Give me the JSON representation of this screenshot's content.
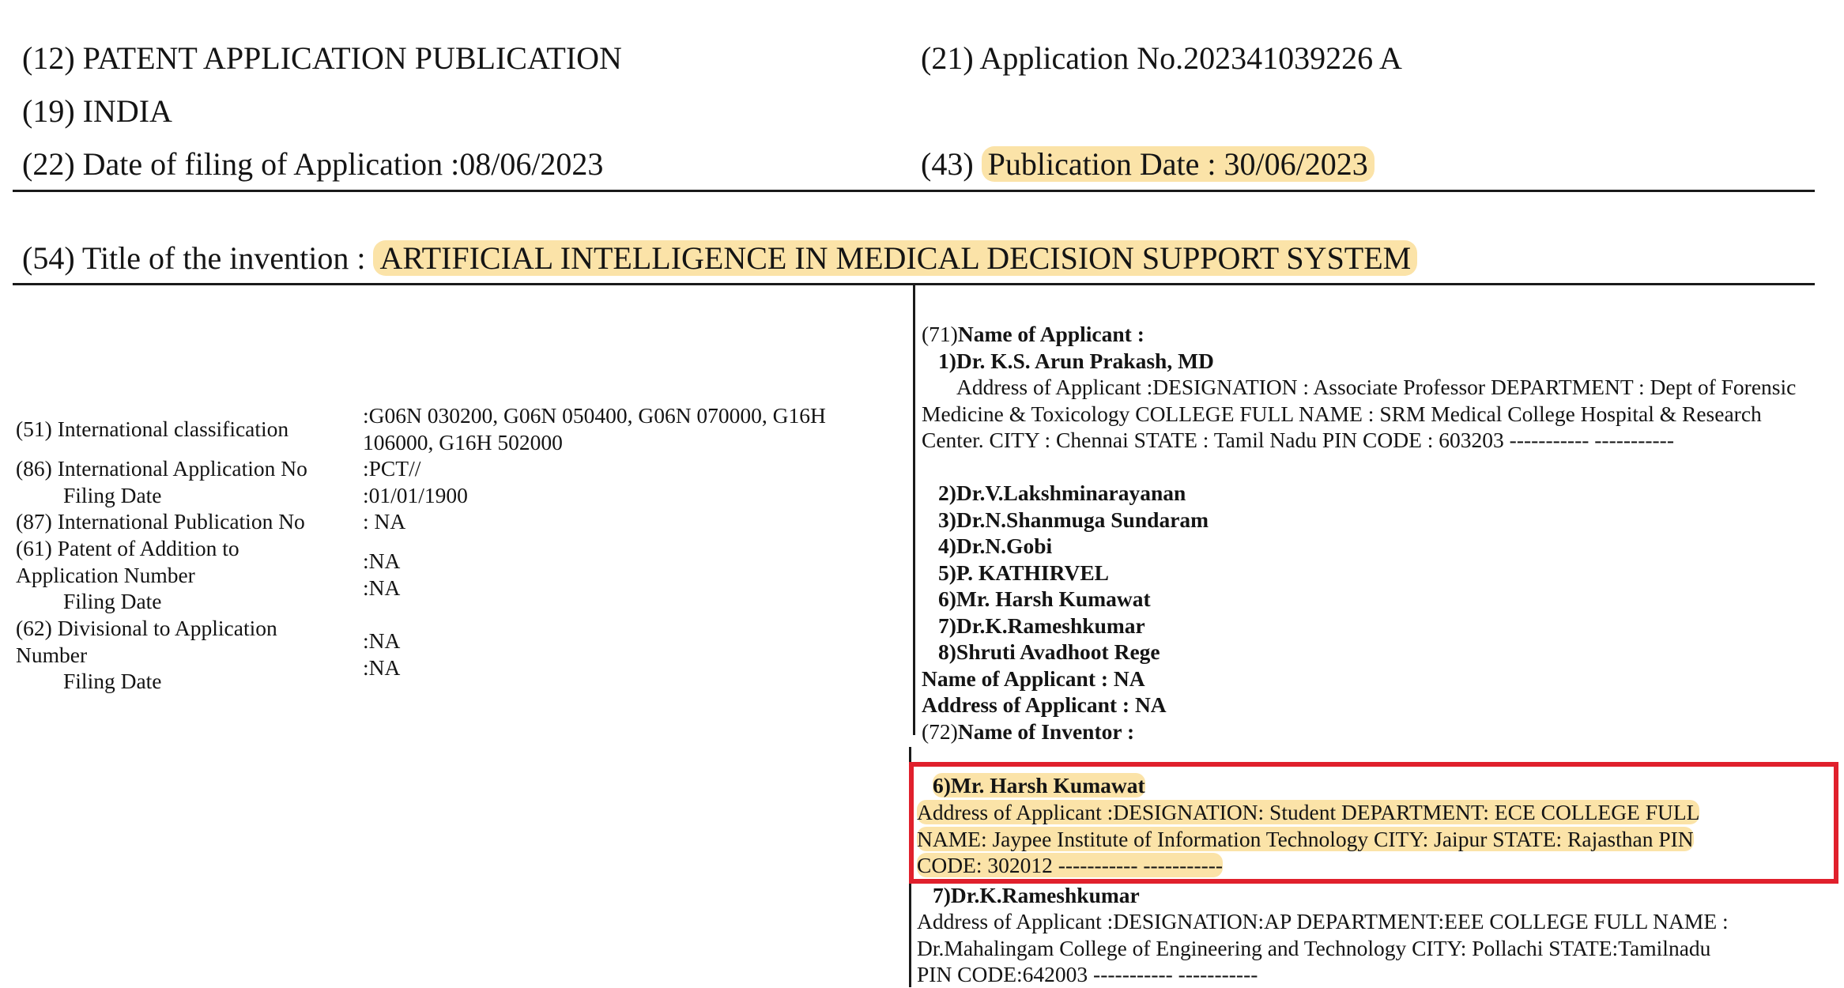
{
  "header": {
    "type_label": "(12) PATENT APPLICATION PUBLICATION",
    "country": "(19) INDIA",
    "filing_date": "(22) Date of filing of Application :08/06/2023",
    "application_no": "(21) Application No.202341039226 A",
    "pub_prefix": "(43)",
    "pub_date": "Publication Date : 30/06/2023"
  },
  "title": {
    "prefix": "(54) Title of the invention :",
    "text": "ARTIFICIAL INTELLIGENCE IN MEDICAL DECISION SUPPORT SYSTEM"
  },
  "left_fields": [
    {
      "label": "(51) International classification",
      "value": ":G06N 030200, G06N 050400, G06N 070000, G16H 106000, G16H 502000"
    },
    {
      "label": "(86) International Application No",
      "value": ":PCT//"
    },
    {
      "label": "Filing Date",
      "value": ":01/01/1900"
    },
    {
      "label": "(87) International Publication No",
      "value": ": NA"
    },
    {
      "label": "(61) Patent of Addition to Application Number",
      "value": ":NA"
    },
    {
      "label": "Filing Date",
      "value": ":NA"
    },
    {
      "label": "(62) Divisional to Application Number",
      "value": ":NA"
    },
    {
      "label": "Filing Date",
      "value": ":NA"
    }
  ],
  "applicant": {
    "heading_prefix": "(71)",
    "heading": "Name of Applicant :",
    "first_name": "1)Dr. K.S. Arun Prakash, MD",
    "first_address": "Address of Applicant :DESIGNATION : Associate Professor DEPARTMENT : Dept of Forensic Medicine & Toxicology COLLEGE FULL NAME : SRM Medical College Hospital & Research Center. CITY : Chennai STATE : Tamil Nadu PIN CODE : 603203 ----------- -----------",
    "others": [
      "2)Dr.V.Lakshminarayanan",
      "3)Dr.N.Shanmuga Sundaram",
      "4)Dr.N.Gobi",
      "5)P. KATHIRVEL",
      "6)Mr. Harsh Kumawat",
      "7)Dr.K.Rameshkumar",
      "8)Shruti Avadhoot Rege"
    ],
    "name_na": "Name of Applicant : NA",
    "address_na": "Address of Applicant : NA"
  },
  "inventor": {
    "heading_prefix": "(72)",
    "heading": "Name of Inventor :",
    "highlighted_name": "6)Mr. Harsh Kumawat",
    "highlighted_lines": [
      "Address of Applicant :DESIGNATION: Student DEPARTMENT: ECE COLLEGE FULL",
      "NAME: Jaypee Institute of Information Technology CITY: Jaipur STATE: Rajasthan PIN",
      "CODE: 302012 ----------- -----------"
    ],
    "next_name": "7)Dr.K.Rameshkumar",
    "next_lines": [
      "Address of Applicant :DESIGNATION:AP DEPARTMENT:EEE COLLEGE FULL NAME :",
      "Dr.Mahalingam College of Engineering and Technology CITY: Pollachi STATE:Tamilnadu",
      "PIN CODE:642003 ----------- -----------"
    ]
  },
  "colors": {
    "highlight": "#fbe3a8",
    "box": "#e0202c",
    "text": "#141414"
  }
}
